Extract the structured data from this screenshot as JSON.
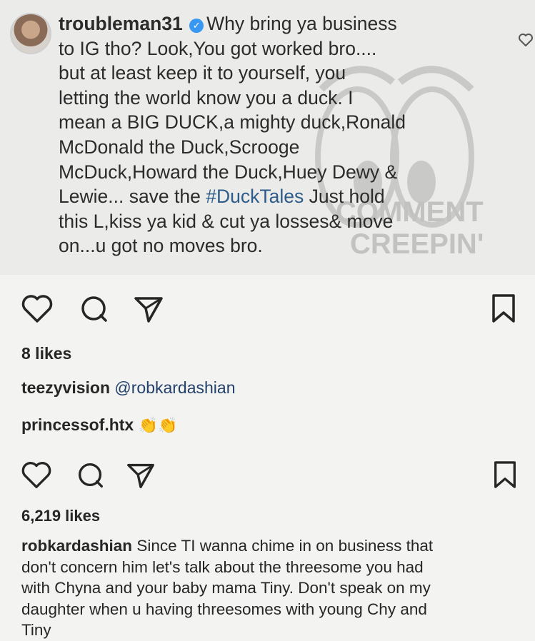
{
  "top_comment": {
    "username": "troubleman31",
    "verified_icon": "verified-badge-icon",
    "text_before_hashtag": "Why bring ya business\nto IG tho? Look,You got worked bro....\nbut at least keep it to yourself, you\nletting the world know you a duck. I\nmean a BIG DUCK,a mighty duck,Ronald\nMcDonald the Duck,Scrooge\nMcDuck,Howard the Duck,Huey Dewy &\nLewie... save the ",
    "hashtag": "#DuckTales",
    "text_after_hashtag": " Just hold\nthis L,kiss ya kid & cut ya losses& move\non...u got no moves bro.",
    "watermark_text": "COMMENT CREEPIN'"
  },
  "post1": {
    "likes": "8 likes",
    "comments": [
      {
        "username": "teezyvision",
        "text": "@robkardashian"
      },
      {
        "username": "princessof.htx",
        "text": "👏👏"
      }
    ]
  },
  "post2": {
    "likes": "6,219 likes",
    "caption_username": "robkardashian",
    "caption_text": "Since TI wanna chime in on business that\ndon't concern him let's talk about the threesome you had\nwith Chyna and your baby mama Tiny. Don't speak on my\ndaughter when u having threesomes with young Chy and\nTiny"
  },
  "colors": {
    "text": "#262626",
    "hashtag": "#2d5b8a",
    "mention": "#23416b",
    "verified": "#3897f0",
    "background": "#f3f3f1"
  }
}
